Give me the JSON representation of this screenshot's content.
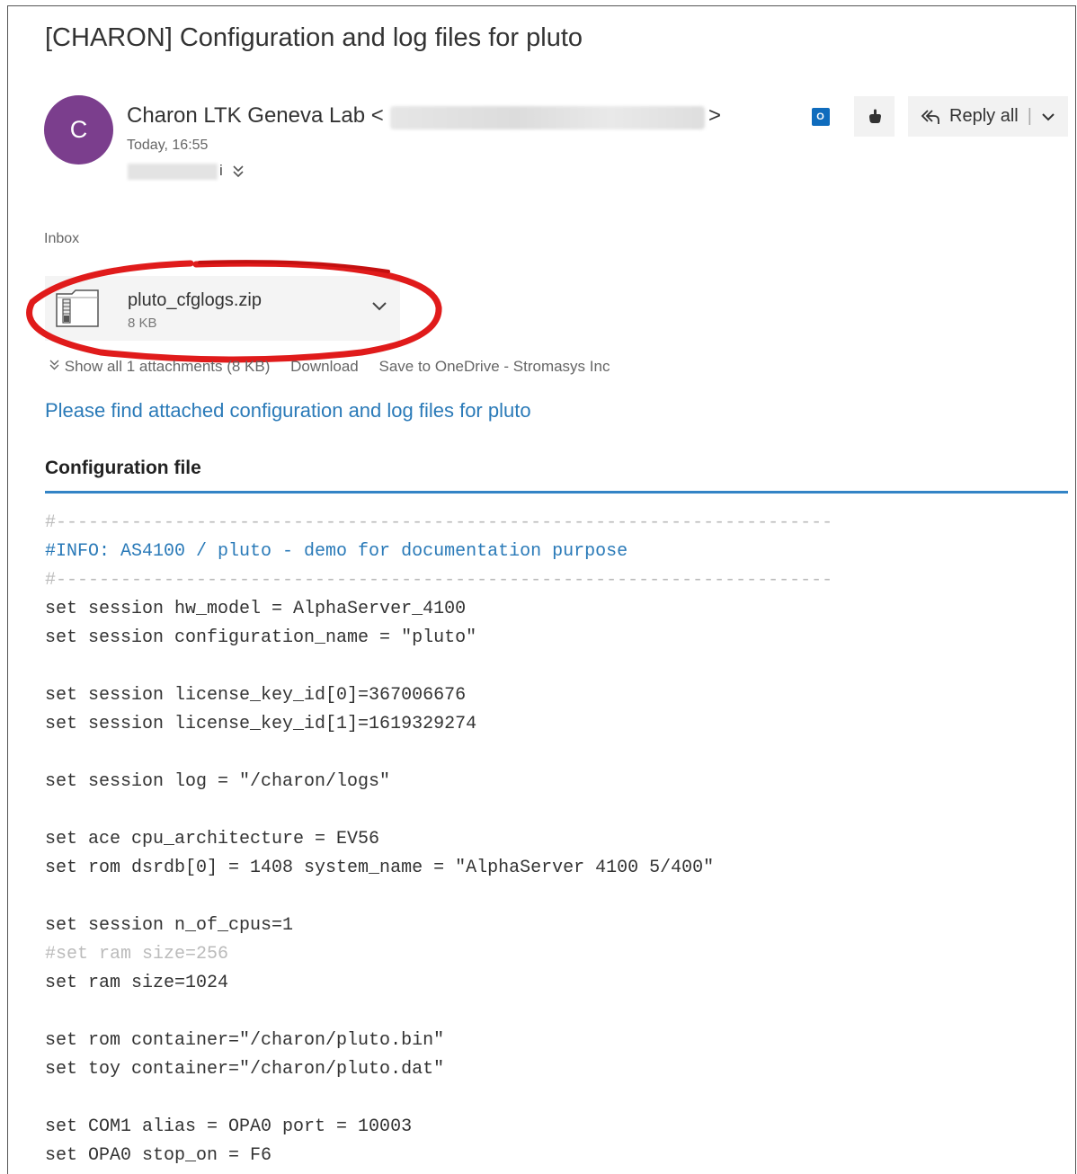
{
  "email": {
    "subject": "[CHARON] Configuration and log files for pluto",
    "sender_initial": "C",
    "sender_name": "Charon LTK Geneva Lab <",
    "sender_email_end": ">",
    "sent_time": "Today, 16:55",
    "recipient_tail": "i",
    "folder": "Inbox"
  },
  "toolbar": {
    "reply_all_label": "Reply all",
    "separator": "|"
  },
  "attachment": {
    "name": "pluto_cfglogs.zip",
    "size": "8 KB",
    "show_all": "Show all 1 attachments (8 KB)",
    "download": "Download",
    "save_onedrive": "Save to OneDrive - Stromasys Inc"
  },
  "body": {
    "intro": "Please find attached configuration and log files for pluto",
    "section_title": "Configuration file",
    "code_lines": [
      {
        "text": "#------------------------------------------------------------------------",
        "style": "gray"
      },
      {
        "text": "#INFO: AS4100 / pluto - demo for documentation purpose",
        "style": "blue"
      },
      {
        "text": "#------------------------------------------------------------------------",
        "style": "gray"
      },
      {
        "text": "set session hw_model = AlphaServer_4100",
        "style": "normal"
      },
      {
        "text": "set session configuration_name = \"pluto\"",
        "style": "normal"
      },
      {
        "text": "",
        "style": "normal"
      },
      {
        "text": "set session license_key_id[0]=367006676",
        "style": "normal"
      },
      {
        "text": "set session license_key_id[1]=1619329274",
        "style": "normal"
      },
      {
        "text": "",
        "style": "normal"
      },
      {
        "text": "set session log = \"/charon/logs\"",
        "style": "normal"
      },
      {
        "text": "",
        "style": "normal"
      },
      {
        "text": "set ace cpu_architecture = EV56",
        "style": "normal"
      },
      {
        "text": "set rom dsrdb[0] = 1408 system_name = \"AlphaServer 4100 5/400\"",
        "style": "normal"
      },
      {
        "text": "",
        "style": "normal"
      },
      {
        "text": "set session n_of_cpus=1",
        "style": "normal"
      },
      {
        "text": "#set ram size=256",
        "style": "gray"
      },
      {
        "text": "set ram size=1024",
        "style": "normal"
      },
      {
        "text": "",
        "style": "normal"
      },
      {
        "text": "set rom container=\"/charon/pluto.bin\"",
        "style": "normal"
      },
      {
        "text": "set toy container=\"/charon/pluto.dat\"",
        "style": "normal"
      },
      {
        "text": "",
        "style": "normal"
      },
      {
        "text": "set COM1 alias = OPA0 port = 10003",
        "style": "normal"
      },
      {
        "text": "set OPA0 stop_on = F6",
        "style": "normal"
      }
    ]
  },
  "icons": {
    "outlook": "outlook-icon",
    "hand": "pointer-hand-icon",
    "reply_all": "reply-all-icon",
    "chevron": "chevron-down-icon",
    "zip": "zip-file-icon",
    "annotation": "red-circle-annotation"
  },
  "colors": {
    "avatar": "#7b3e8d",
    "link": "#2a7ab8",
    "rule": "#3384c6",
    "annotation": "#e01b1b"
  }
}
